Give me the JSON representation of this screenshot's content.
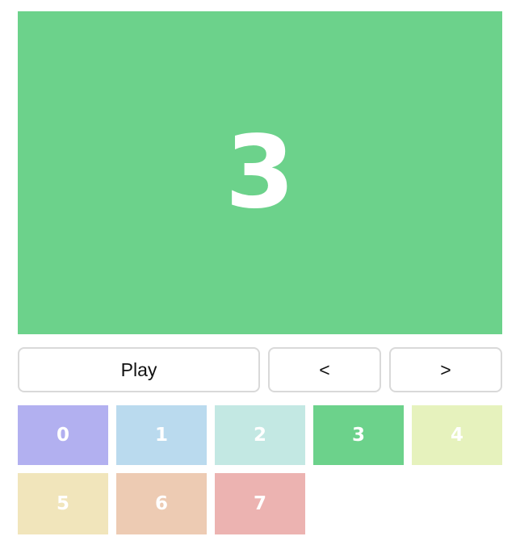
{
  "stage": {
    "current_label": "3",
    "color": "#6cd28b"
  },
  "controls": {
    "play_label": "Play",
    "prev_label": "<",
    "next_label": ">"
  },
  "tiles": [
    {
      "label": "0",
      "color": "#b2b0f0"
    },
    {
      "label": "1",
      "color": "#badaee"
    },
    {
      "label": "2",
      "color": "#c3e8e3"
    },
    {
      "label": "3",
      "color": "#6cd28b"
    },
    {
      "label": "4",
      "color": "#e6f2bd"
    },
    {
      "label": "5",
      "color": "#f1e5bb"
    },
    {
      "label": "6",
      "color": "#edcbb3"
    },
    {
      "label": "7",
      "color": "#ecb3b1"
    }
  ],
  "selected_index": 3
}
